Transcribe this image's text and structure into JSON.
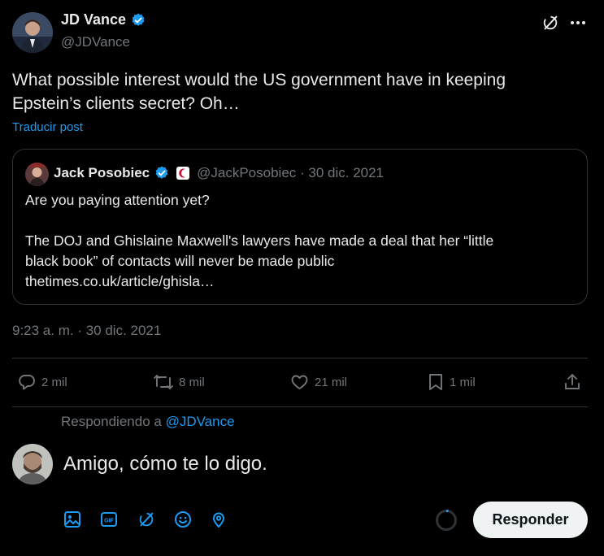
{
  "colors": {
    "accent": "#1d9bf0",
    "background": "#000000",
    "text": "#e7e9ea",
    "muted": "#71767b",
    "divider": "#2f3336"
  },
  "author": {
    "name": "JD Vance",
    "handle": "@JDVance",
    "verified": true
  },
  "tweet": {
    "text_line1": "What possible interest would the US government have in keeping",
    "text_line2": "Epstein’s clients secret? Oh…",
    "translate_label": "Traducir post",
    "timestamp": "9:23 a. m. · 30 dic. 2021"
  },
  "quoted": {
    "name": "Jack Posobiec",
    "handle_date": "@JackPosobiec · 30 dic. 2021",
    "line1": "Are you paying attention yet?",
    "line2": "The DOJ and Ghislaine Maxwell's lawyers have made a deal that her “little",
    "line3": "black book” of contacts will never be made public",
    "line4": "thetimes.co.uk/article/ghisla…"
  },
  "actions": {
    "replies": "2 mil",
    "reposts": "8 mil",
    "likes": "21 mil",
    "bookmarks": "1 mil"
  },
  "reply": {
    "replying_prefix": "Respondiendo a",
    "replying_handle": "@JDVance",
    "draft_text": "Amigo, cómo te lo digo.",
    "button_label": "Responder",
    "tools": [
      "image-icon",
      "gif-icon",
      "grok-icon",
      "emoji-icon",
      "location-icon"
    ]
  },
  "header_icons": [
    "grok-icon",
    "more-icon"
  ]
}
